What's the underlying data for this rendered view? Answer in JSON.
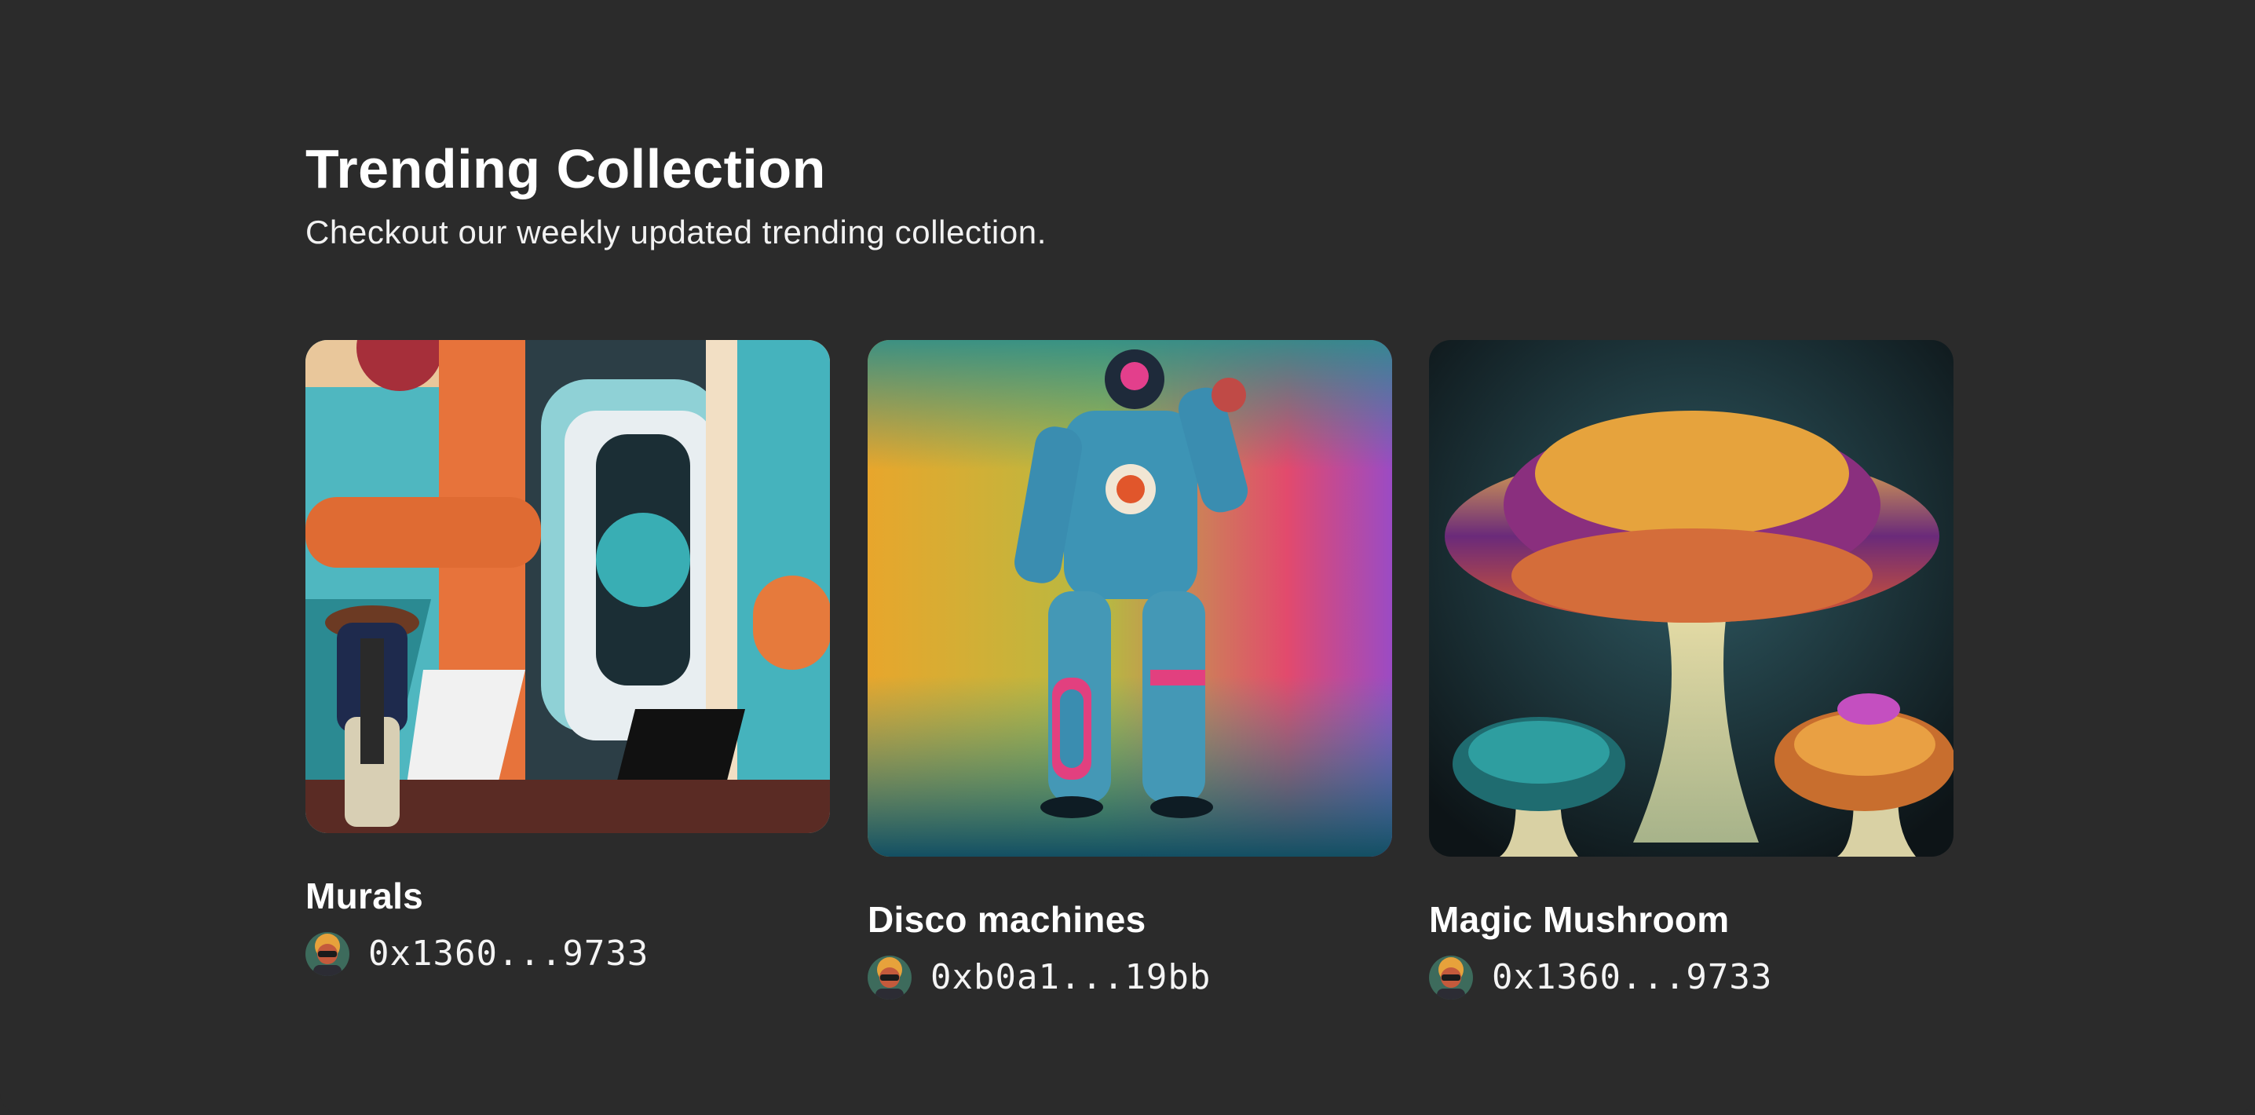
{
  "section": {
    "title": "Trending Collection",
    "subtitle": "Checkout our weekly updated trending collection."
  },
  "colors": {
    "background": "#2b2b2b",
    "text": "#ffffff"
  },
  "collections": [
    {
      "name": "Murals",
      "artist_address": "0x1360...9733",
      "image": "mural-artwork-image"
    },
    {
      "name": "Disco machines",
      "artist_address": "0xb0a1...19bb",
      "image": "astronaut-artwork-image"
    },
    {
      "name": "Magic Mushroom",
      "artist_address": "0x1360...9733",
      "image": "mushroom-artwork-image"
    }
  ]
}
